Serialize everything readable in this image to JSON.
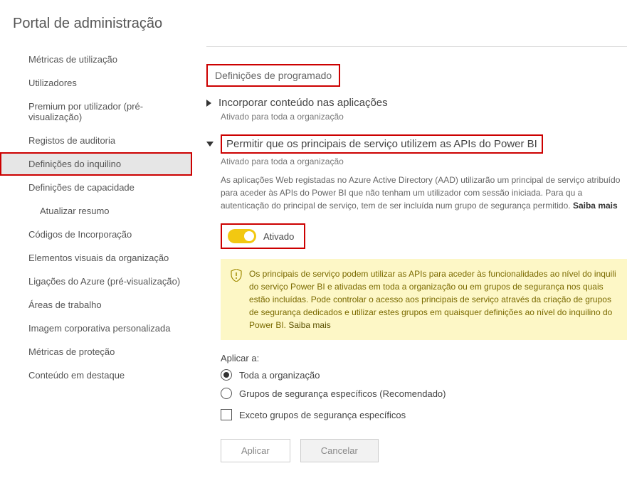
{
  "page_title": "Portal de administração",
  "sidebar": {
    "items": [
      {
        "label": "Métricas de utilização"
      },
      {
        "label": "Utilizadores"
      },
      {
        "label": "Premium por utilizador (pré-visualização)"
      },
      {
        "label": "Registos de auditoria"
      },
      {
        "label": "Definições do inquilino"
      },
      {
        "label": "Definições de capacidade"
      },
      {
        "label": "Atualizar resumo"
      },
      {
        "label": "Códigos de Incorporação"
      },
      {
        "label": "Elementos visuais da organização"
      },
      {
        "label": "Ligações do Azure (pré-visualização)"
      },
      {
        "label": "Áreas de trabalho"
      },
      {
        "label": "Imagem corporativa personalizada"
      },
      {
        "label": "Métricas de proteção"
      },
      {
        "label": "Conteúdo em destaque"
      }
    ]
  },
  "section_header": "Definições de programado",
  "setting_collapsed": {
    "title": "Incorporar conteúdo nas aplicações",
    "status": "Ativado para toda a organização"
  },
  "setting_expanded": {
    "title": "Permitir que os principais de serviço utilizem as APIs do Power BI",
    "status": "Ativado para toda a organização",
    "description": "As aplicações Web registadas no Azure Active Directory (AAD) utilizarão um principal de serviço atribuído para aceder às APIs do Power BI que não tenham um utilizador com sessão iniciada. Para qu a autenticação do principal de serviço, tem de ser incluída num grupo de segurança permitido.",
    "learn_more": "Saiba mais",
    "toggle_label": "Ativado",
    "warning_text": "Os principais de serviço podem utilizar as APIs para aceder às funcionalidades ao nível do inquili do serviço Power BI e ativadas em toda a organização ou em grupos de segurança nos quais estão incluídas. Pode controlar o acesso aos principais de serviço através da criação de grupos de segurança dedicados e utilizar estes grupos em quaisquer definições ao nível do inquilino do Power BI.",
    "warning_learn_more": "Saiba mais",
    "apply_to_label": "Aplicar a:",
    "radio1": "Toda a organização",
    "radio2": "Grupos de segurança específicos (Recomendado)",
    "checkbox": "Exceto grupos de segurança específicos",
    "apply_btn": "Aplicar",
    "cancel_btn": "Cancelar"
  }
}
